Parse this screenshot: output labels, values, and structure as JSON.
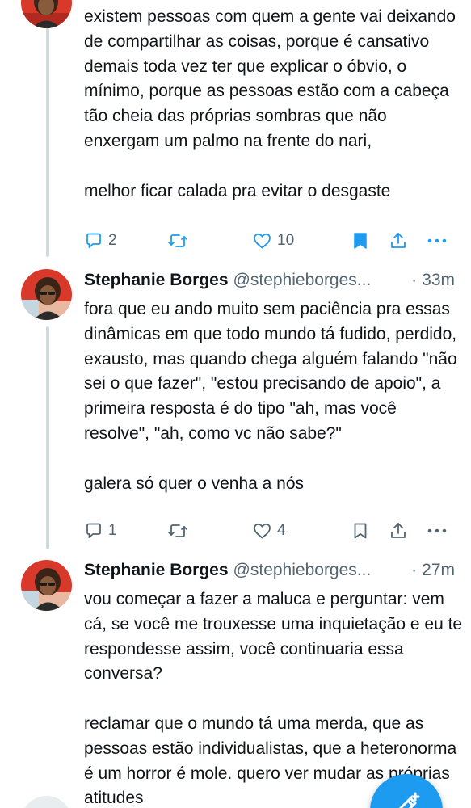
{
  "tweets": [
    {
      "text": [
        "existem pessoas com quem a gente vai deixando de compartilhar as coisas, porque é cansativo demais toda vez ter que explicar o óbvio, o mínimo, porque as pessoas estão com a cabeça tão cheia das próprias sombras que não enxergam um palmo na frente do nari,",
        "melhor ficar calada pra evitar o desgaste"
      ],
      "replies": "2",
      "likes": "10",
      "bookmarked": true
    },
    {
      "author_name": "Stephanie Borges",
      "handle": "@stephieborges...",
      "separator": "·",
      "time": "33m",
      "text": [
        "fora que eu ando muito sem paciência pra essas dinâmicas em que todo mundo tá fudido, perdido, exausto, mas quando chega alguém falando \"não sei o que fazer\", \"estou precisando de apoio\", a primeira resposta é do tipo \"ah, mas você resolve\", \"ah, como vc não sabe?\"",
        "galera só quer o venha a nós"
      ],
      "replies": "1",
      "likes": "4",
      "bookmarked": false
    },
    {
      "author_name": "Stephanie Borges",
      "handle": "@stephieborges...",
      "separator": "·",
      "time": "27m",
      "text": [
        "vou começar a fazer a maluca e perguntar: vem cá, se você me trouxesse uma inquietação e eu te respondesse assim, você continuaria essa conversa?",
        "reclamar que o mundo tá uma merda, que as pessoas estão individualistas, que a heteronorma é um horror é mole. quero ver mudar as próprias atitudes"
      ]
    }
  ],
  "icons": {
    "reply": "reply-icon",
    "retweet": "retweet-icon",
    "like": "heart-icon",
    "bookmark": "bookmark-icon",
    "share": "share-icon",
    "more": "more-icon",
    "compose": "compose-icon"
  },
  "colors": {
    "text": "#0f1419",
    "secondary": "#536471",
    "accent": "#1d9bf0",
    "thread_line": "#cfd9de",
    "avatar_bg": "#d9392b"
  }
}
